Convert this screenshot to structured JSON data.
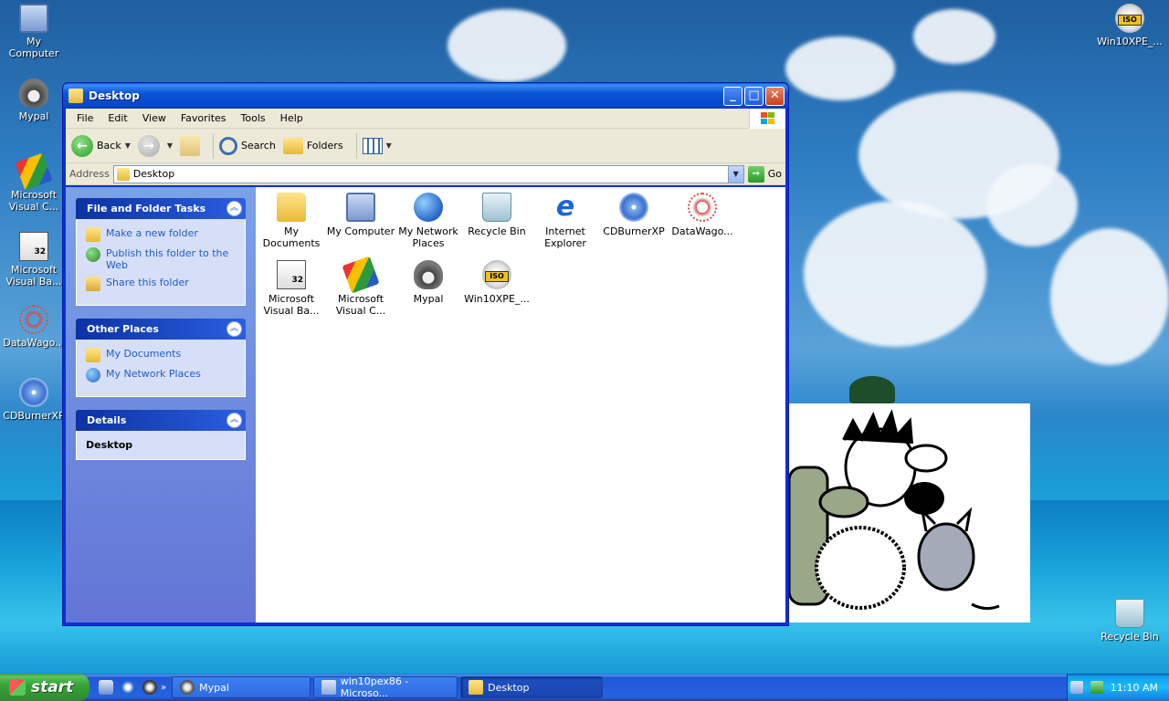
{
  "desktop": {
    "icons_left": [
      {
        "label": "My Computer",
        "icon": "computer-icon"
      },
      {
        "label": "Mypal",
        "icon": "raccoon-icon"
      },
      {
        "label": "Microsoft Visual C...",
        "icon": "visual-c-icon"
      },
      {
        "label": "Microsoft Visual Ba...",
        "icon": "visual-basic-icon"
      },
      {
        "label": "DataWago...",
        "icon": "datawagon-icon"
      },
      {
        "label": "CDBurnerXP",
        "icon": "cd-icon"
      }
    ],
    "icon_top_right": {
      "label": "Win10XPE_...",
      "iso": "ISO"
    },
    "icon_bottom_right": {
      "label": "Recycle Bin"
    }
  },
  "window": {
    "title": "Desktop",
    "menu": [
      "File",
      "Edit",
      "View",
      "Favorites",
      "Tools",
      "Help"
    ],
    "toolbar": {
      "back": "Back",
      "search": "Search",
      "folders": "Folders"
    },
    "address": {
      "label": "Address",
      "value": "Desktop",
      "go": "Go"
    },
    "taskpane": {
      "file_tasks": {
        "title": "File and Folder Tasks",
        "items": [
          "Make a new folder",
          "Publish this folder to the Web",
          "Share this folder"
        ]
      },
      "other_places": {
        "title": "Other Places",
        "items": [
          "My Documents",
          "My Network Places"
        ]
      },
      "details": {
        "title": "Details",
        "name": "Desktop"
      }
    },
    "files": [
      {
        "label": "My Documents",
        "icon": "folder-icon"
      },
      {
        "label": "My Computer",
        "icon": "computer-icon"
      },
      {
        "label": "My Network Places",
        "icon": "network-icon"
      },
      {
        "label": "Recycle Bin",
        "icon": "recycle-bin-icon"
      },
      {
        "label": "Internet Explorer",
        "icon": "ie-icon"
      },
      {
        "label": "CDBurnerXP",
        "icon": "cd-icon"
      },
      {
        "label": "DataWago...",
        "icon": "datawagon-icon"
      },
      {
        "label": "Microsoft Visual Ba...",
        "icon": "visual-basic-icon"
      },
      {
        "label": "Microsoft Visual C...",
        "icon": "visual-c-icon"
      },
      {
        "label": "Mypal",
        "icon": "raccoon-icon"
      },
      {
        "label": "Win10XPE_...",
        "icon": "iso-icon"
      }
    ],
    "iso_badge": "ISO",
    "vb_badge": "32"
  },
  "taskbar": {
    "start": "start",
    "tasks": [
      {
        "label": "Mypal"
      },
      {
        "label": "win10pex86 - Microso..."
      },
      {
        "label": "Desktop"
      }
    ],
    "clock": "11:10 AM"
  },
  "colors": {
    "xp_blue": "#0831d9",
    "task_link": "#215dc6",
    "start_green": "#37a337"
  }
}
